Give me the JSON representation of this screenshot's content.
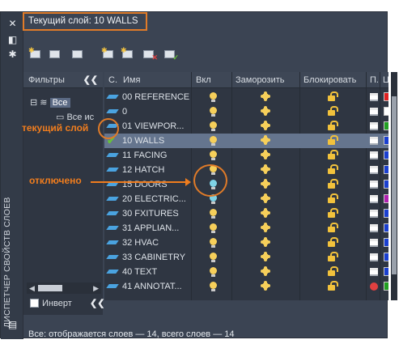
{
  "current_layer": "Текущий слой: 10 WALLS",
  "palette_title": "ДИСПЕТЧЕР СВОЙСТВ СЛОЕВ",
  "filters": {
    "header": "Фильтры",
    "root": "Все",
    "child": "Все ис",
    "invert_label": "Инверт"
  },
  "columns": {
    "status": "С.",
    "name": "Имя",
    "on": "Вкл",
    "freeze": "Заморозить",
    "lock": "Блокировать",
    "plot": "П.",
    "color": "Ц"
  },
  "layers": [
    {
      "name": "00 REFERENCE",
      "on": true,
      "color": "#e02020",
      "plot": true
    },
    {
      "name": "0",
      "on": true,
      "color": "#ffffff",
      "plot": true
    },
    {
      "name": "01 VIEWPOR...",
      "on": true,
      "color": "#22a022",
      "plot": true
    },
    {
      "name": "10 WALLS",
      "on": true,
      "color": "#1a3fd0",
      "plot": true,
      "current": true
    },
    {
      "name": "11 FACING",
      "on": true,
      "color": "#1a3fd0",
      "plot": true
    },
    {
      "name": "12 HATCH",
      "on": true,
      "color": "#1a3fd0",
      "plot": true
    },
    {
      "name": "15 DOORS",
      "on": false,
      "color": "#1a3fd0",
      "plot": true
    },
    {
      "name": "20 ELECTRIC...",
      "on": false,
      "color": "#b020b0",
      "plot": true
    },
    {
      "name": "30 FXITURES",
      "on": true,
      "color": "#1a3fd0",
      "plot": true
    },
    {
      "name": "31 APPLIAN...",
      "on": true,
      "color": "#1a3fd0",
      "plot": true
    },
    {
      "name": "32 HVAC",
      "on": true,
      "color": "#1a3fd0",
      "plot": true
    },
    {
      "name": "33 CABINETRY",
      "on": true,
      "color": "#1a3fd0",
      "plot": true
    },
    {
      "name": "40 TEXT",
      "on": true,
      "color": "#1a3fd0",
      "plot": true
    },
    {
      "name": "41 ANNOTAT...",
      "on": true,
      "color": "#22a022",
      "plot": false
    }
  ],
  "status_text": "Все: отображается слоев — 14, всего слоев — 14",
  "annotations": {
    "current": "текущий слой",
    "off": "отключено"
  },
  "accent_color": "#e07b28"
}
